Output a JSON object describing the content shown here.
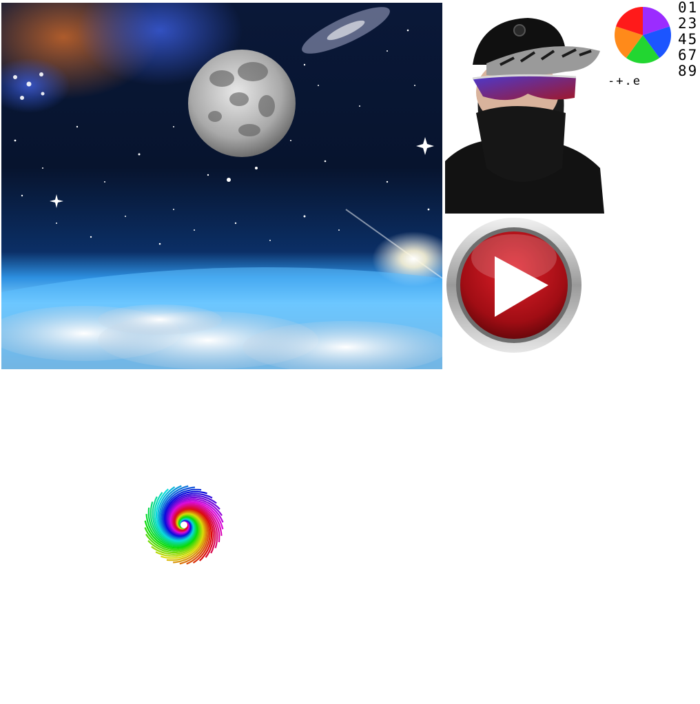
{
  "images": {
    "space": {
      "icon": "space-moon-earth-image"
    },
    "person": {
      "icon": "masked-person-photo"
    },
    "play_button": {
      "icon": "play-icon",
      "colors": {
        "ring": "#b8b8b8",
        "face": "#c0161d",
        "arrow": "#ffffff"
      }
    },
    "spiral": {
      "icon": "rainbow-spiral-image"
    }
  },
  "pie": {
    "icon": "color-pie-icon",
    "slices": [
      {
        "color": "#9b2cff"
      },
      {
        "color": "#1c55ff"
      },
      {
        "color": "#22d631"
      },
      {
        "color": "#ff8a1a"
      },
      {
        "color": "#ff1a1a"
      }
    ]
  },
  "glyphs": {
    "rows": [
      "01",
      "23",
      "45",
      "67",
      "89"
    ],
    "symbols": "-+.e"
  }
}
